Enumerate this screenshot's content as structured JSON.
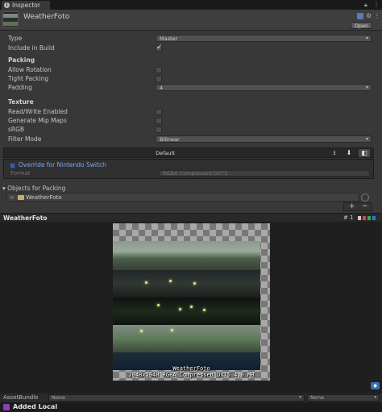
{
  "tab": {
    "label": "Inspector"
  },
  "asset": {
    "name": "WeatherFoto",
    "open_label": "Open"
  },
  "fields": {
    "type_label": "Type",
    "type_value": "Master",
    "include_label": "Include in Build",
    "packing_header": "Packing",
    "allow_rotation_label": "Allow Rotation",
    "tight_packing_label": "Tight Packing",
    "padding_label": "Padding",
    "padding_value": "4",
    "texture_header": "Texture",
    "readwrite_label": "Read/Write Enabled",
    "mipmaps_label": "Generate Mip Maps",
    "srgb_label": "sRGB",
    "filter_label": "Filter Mode",
    "filter_value": "Bilinear"
  },
  "checkboxes": {
    "include_in_build": true,
    "allow_rotation": false,
    "tight_packing": false,
    "read_write": false,
    "mip_maps": false,
    "srgb": false
  },
  "platform": {
    "default_label": "Default",
    "override_label": "Override for Nintendo Switch",
    "format_label": "Format",
    "format_value": "RGBA Compressed DXT5",
    "icons": [
      "download-icon",
      "download-icon",
      "switch-icon"
    ]
  },
  "objects": {
    "header": "Objects for Packing",
    "items": [
      "WeatherFoto"
    ],
    "add_label": "+",
    "remove_label": "−"
  },
  "preview": {
    "title": "WeatherFoto",
    "page_label": "# 1",
    "image_name": "WeatherFoto",
    "image_info": "2048x2048 RGBA Compressed DXT5   4.0 MB"
  },
  "asset_bundle": {
    "label": "AssetBundle",
    "name_value": "None",
    "variant_value": "None"
  },
  "status": {
    "label": "Added Local"
  },
  "colors": {
    "accent_blue": "#3d5fa0",
    "override_text": "#7fa8e8",
    "status_purple": "#8b3fb8"
  }
}
